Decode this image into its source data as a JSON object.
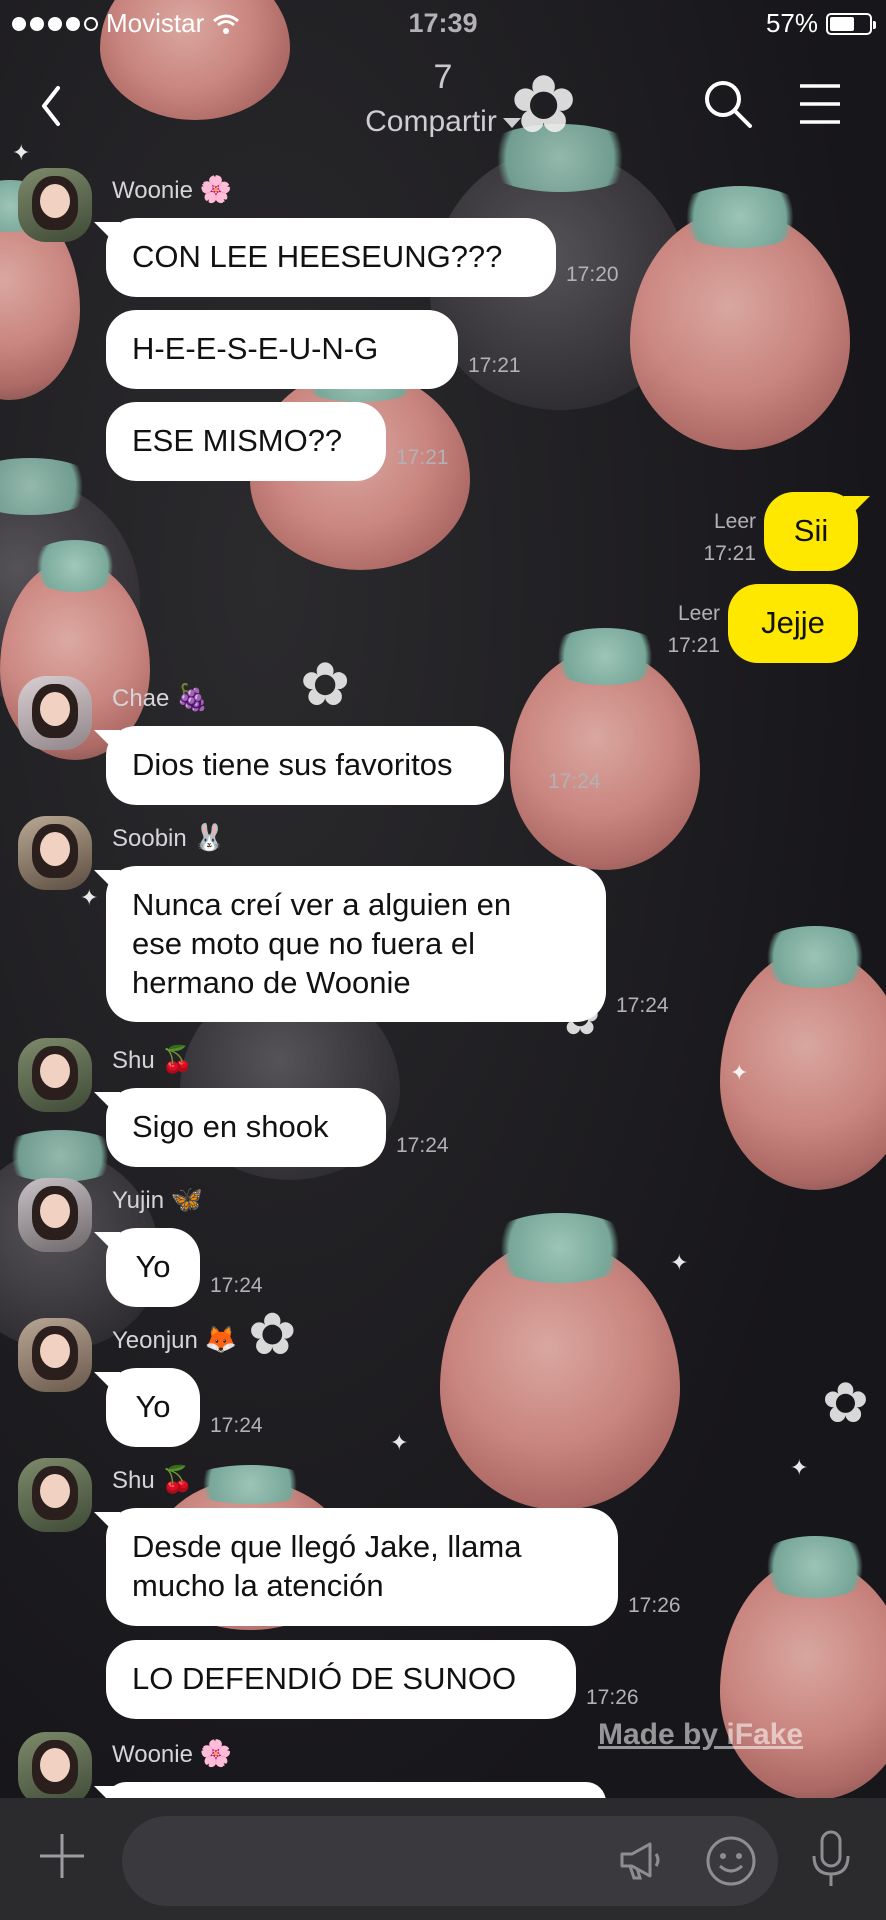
{
  "status_bar": {
    "carrier": "Movistar",
    "time": "17:39",
    "battery": "57%",
    "battery_level": 0.57
  },
  "header": {
    "count": "7",
    "share_label": "Compartir",
    "icons": [
      "back-icon",
      "search-icon",
      "menu-icon"
    ]
  },
  "messages": [
    {
      "sender": "Woonie",
      "sender_emoji": "🌸",
      "text": "CON LEE HEESEUNG???",
      "time": "17:20"
    },
    {
      "text": "H-E-E-S-E-U-N-G",
      "time": "17:21"
    },
    {
      "text": "ESE MISMO??",
      "time": "17:21"
    },
    {
      "mine": true,
      "read": "Leer",
      "text": "Sii",
      "time": "17:21"
    },
    {
      "mine": true,
      "read": "Leer",
      "text": "Jejje",
      "time": "17:21"
    },
    {
      "sender": "Chae",
      "sender_emoji": "🍇",
      "text": "Dios tiene sus favoritos",
      "time": "17:24"
    },
    {
      "sender": "Soobin",
      "sender_emoji": "🐰",
      "text_lines": [
        "Nunca creí ver a alguien en",
        "ese moto que no fuera el",
        "hermano de Woonie"
      ],
      "time": "17:24"
    },
    {
      "sender": "Shu",
      "sender_emoji": "🍒",
      "text": "Sigo en shook",
      "time": "17:24"
    },
    {
      "sender": "Yujin",
      "sender_emoji": "🦋",
      "text": "Yo",
      "time": "17:24"
    },
    {
      "sender": "Yeonjun",
      "sender_emoji": "🦊",
      "text": "Yo",
      "time": "17:24"
    },
    {
      "sender": "Shu",
      "sender_emoji": "🍒",
      "text_lines": [
        "Desde que llegó Jake, llama",
        "mucho la atención"
      ],
      "time": "17:26"
    },
    {
      "text": "LO DEFENDIÓ DE SUNOO",
      "time": "17:26"
    },
    {
      "sender": "Woonie",
      "sender_emoji": "🌸"
    }
  ],
  "watermark": "Made by iFake",
  "bottom_bar": {
    "icons": [
      "plus-icon",
      "megaphone-icon",
      "emoji-icon",
      "microphone-icon"
    ]
  },
  "colors": {
    "my_bubble": "#ffe800",
    "their_bubble": "#ffffff",
    "bottom_bar": "#2b2a2d"
  }
}
